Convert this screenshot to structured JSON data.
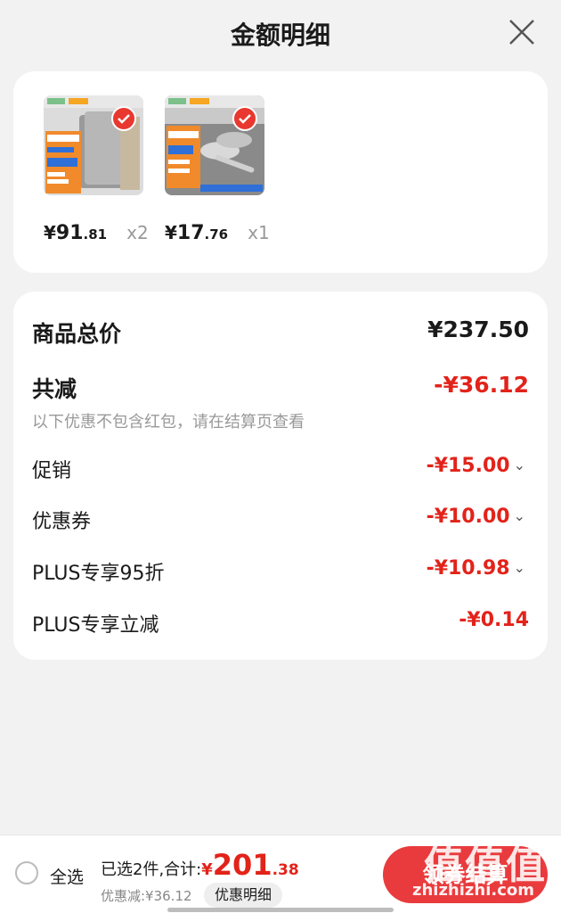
{
  "header": {
    "title": "金额明细"
  },
  "products": [
    {
      "yen": "¥",
      "price_int": "91",
      "price_dec": ".81",
      "qty": "x2"
    },
    {
      "yen": "¥",
      "price_int": "17",
      "price_dec": ".76",
      "qty": "x1"
    }
  ],
  "detail": {
    "total_label": "商品总价",
    "total_value": "¥237.50",
    "reduce_label": "共减",
    "reduce_value": "-¥36.12",
    "note": "以下优惠不包含红包，请在结算页查看",
    "items": [
      {
        "label": "促销",
        "value": "-¥15.00"
      },
      {
        "label": "优惠券",
        "value": "-¥10.00"
      },
      {
        "label": "PLUS专享95折",
        "value": "-¥10.98"
      },
      {
        "label": "PLUS专享立减",
        "value": "-¥0.14"
      }
    ]
  },
  "bottom": {
    "select_all": "全选",
    "selected_text": "已选2件,合计:",
    "total_yen": "¥",
    "total_int": "201",
    "total_dec": ".38",
    "discount_text": "优惠减:¥36.12",
    "detail_button": "优惠明细",
    "checkout_button": "领券结算"
  },
  "watermark": {
    "big": "值值值",
    "small": "zhizhizhi.com"
  },
  "colors": {
    "accent_red": "#e2231a",
    "checkout_red": "#e93b3d",
    "background": "#f2f2f2"
  }
}
